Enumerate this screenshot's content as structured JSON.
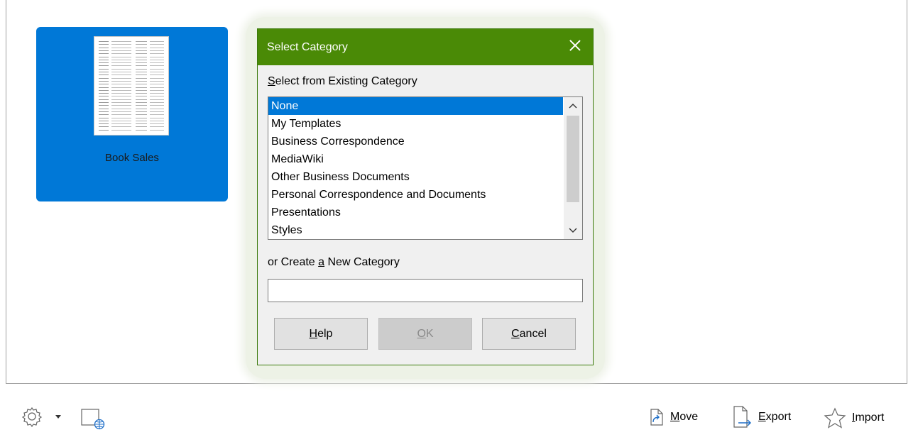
{
  "templates": [
    {
      "name": "Book Sales",
      "selected": true
    }
  ],
  "toolbar": {
    "settings_icon": "gear-icon",
    "dropdown_icon": "caret-down-icon",
    "online_icon": "online-templates-icon",
    "move": {
      "label_pre": "",
      "label_accel": "M",
      "label_post": "ove",
      "icon": "move-icon"
    },
    "export": {
      "label_pre": "",
      "label_accel": "E",
      "label_post": "xport",
      "icon": "export-icon"
    },
    "import": {
      "label_pre": "",
      "label_accel": "I",
      "label_post": "mport",
      "icon": "star-icon"
    }
  },
  "dialog": {
    "title": "Select Category",
    "existing_label_accel": "S",
    "existing_label_rest": "elect from Existing Category",
    "categories": [
      "None",
      "My Templates",
      "Business Correspondence",
      "MediaWiki",
      "Other Business Documents",
      "Personal Correspondence and Documents",
      "Presentations",
      "Styles"
    ],
    "selected_category": "None",
    "new_label_pre": "or Create ",
    "new_label_accel": "a",
    "new_label_post": " New Category",
    "new_category_value": "",
    "buttons": {
      "help": {
        "accel": "H",
        "rest": "elp"
      },
      "ok": {
        "accel": "O",
        "rest": "K",
        "disabled": true
      },
      "cancel": {
        "accel": "C",
        "rest": "ancel"
      }
    },
    "accent_color": "#4a8a06",
    "selection_color": "#0078d7"
  }
}
